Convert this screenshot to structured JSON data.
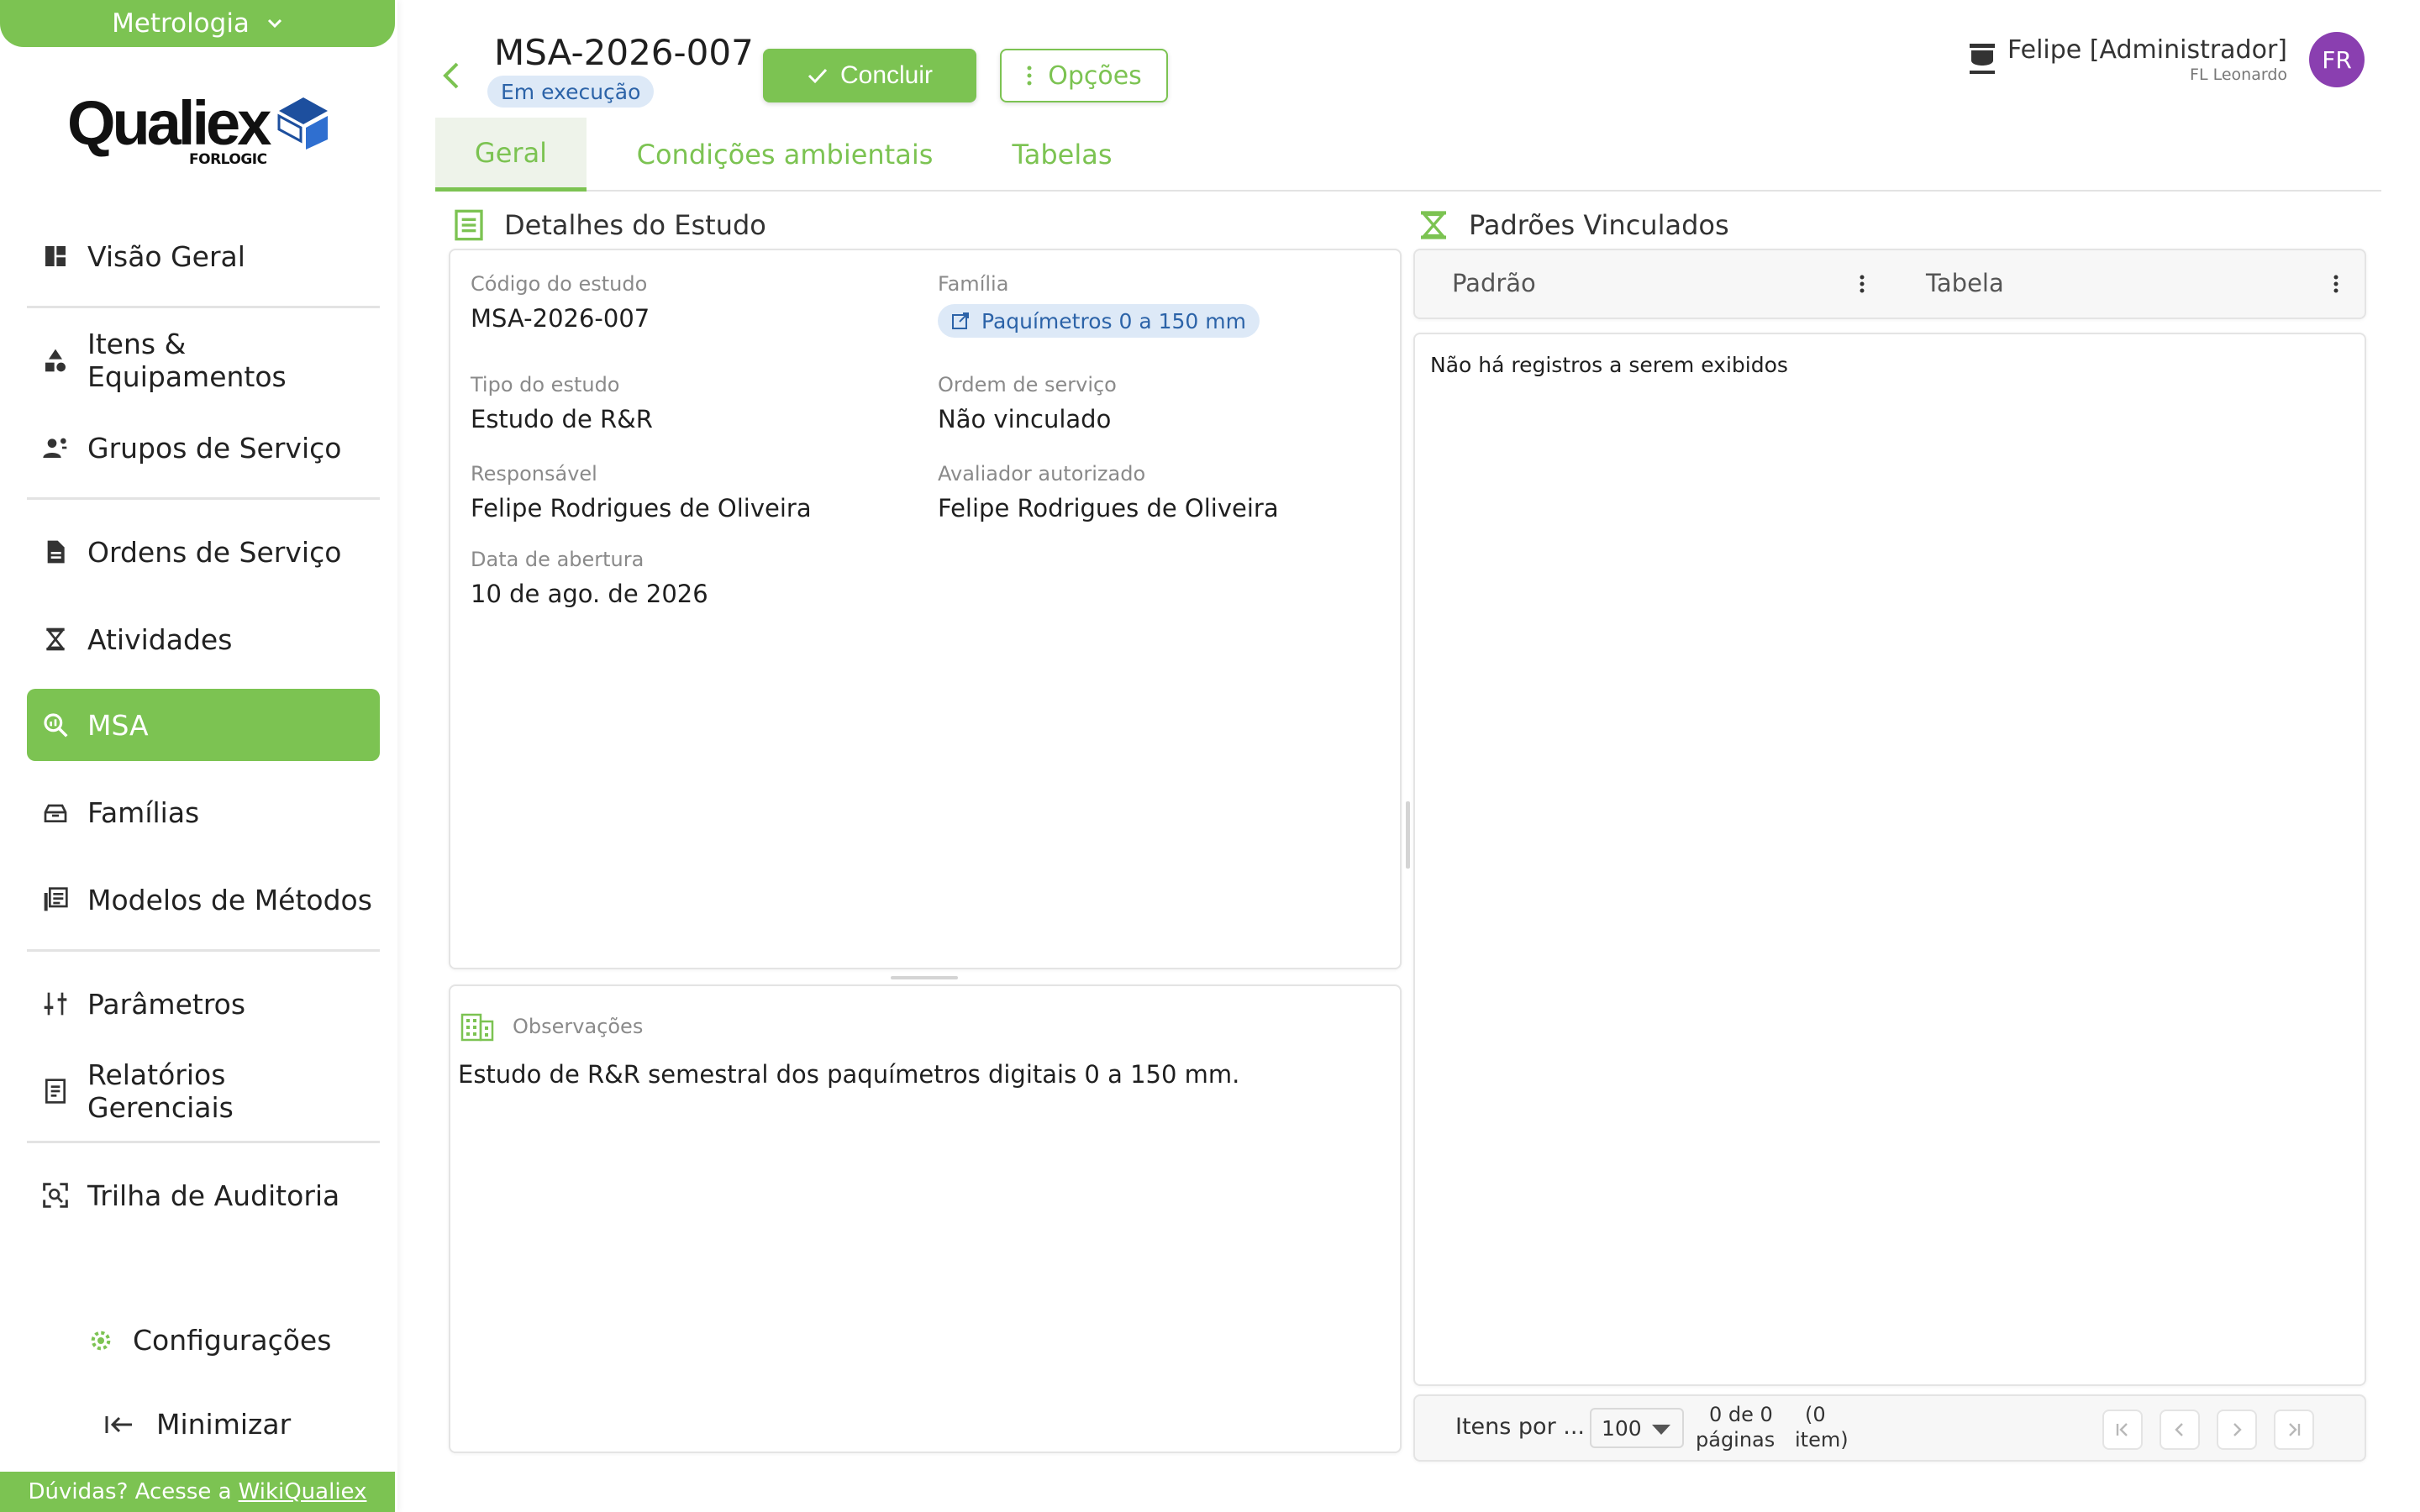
{
  "sidebar": {
    "module": "Metrologia",
    "logo": {
      "word": "Qualiex",
      "sub": "FORLOGIC"
    },
    "items": [
      {
        "label": "Visão Geral",
        "icon": "dashboard-icon"
      },
      {
        "label": "Itens & Equipamentos",
        "icon": "shapes-icon"
      },
      {
        "label": "Grupos de Serviço",
        "icon": "group-icon"
      },
      {
        "label": "Ordens de Serviço",
        "icon": "document-icon"
      },
      {
        "label": "Atividades",
        "icon": "hourglass-icon"
      },
      {
        "label": "MSA",
        "icon": "search-chart-icon",
        "active": true
      },
      {
        "label": "Famílias",
        "icon": "box-icon"
      },
      {
        "label": "Modelos de Métodos",
        "icon": "library-icon"
      },
      {
        "label": "Parâmetros",
        "icon": "sliders-icon"
      },
      {
        "label": "Relatórios Gerenciais",
        "icon": "report-icon"
      },
      {
        "label": "Trilha de Auditoria",
        "icon": "audit-icon"
      }
    ],
    "settings_label": "Configurações",
    "minimize_label": "Minimizar",
    "help_text": "Dúvidas? Acesse a",
    "help_link": "WikiQualiex"
  },
  "header": {
    "title": "MSA-2026-007",
    "status": "Em execução",
    "conclude_label": "Concluir",
    "options_label": "Opções",
    "user_name": "Felipe [Administrador]",
    "user_org": "FL Leonardo",
    "avatar_initials": "FR"
  },
  "tabs": [
    {
      "label": "Geral",
      "active": true
    },
    {
      "label": "Condições ambientais",
      "active": false
    },
    {
      "label": "Tabelas",
      "active": false
    }
  ],
  "details": {
    "section_title": "Detalhes do Estudo",
    "fields": {
      "codigo": {
        "label": "Código do estudo",
        "value": "MSA-2026-007"
      },
      "familia": {
        "label": "Família",
        "value": "Paquímetros 0 a 150 mm"
      },
      "tipo": {
        "label": "Tipo do estudo",
        "value": "Estudo de R&R"
      },
      "ordem": {
        "label": "Ordem de serviço",
        "value": "Não vinculado"
      },
      "responsavel": {
        "label": "Responsável",
        "value": "Felipe Rodrigues de Oliveira"
      },
      "avaliador": {
        "label": "Avaliador autorizado",
        "value": "Felipe Rodrigues de Oliveira"
      },
      "data": {
        "label": "Data de abertura",
        "value": "10 de ago. de 2026"
      }
    },
    "observations_label": "Observações",
    "observations_text": "Estudo de R&R semestral dos paquímetros digitais 0 a 150 mm."
  },
  "standards": {
    "section_title": "Padrões Vinculados",
    "columns": [
      "Padrão",
      "Tabela"
    ],
    "empty_message": "Não há registros a serem exibidos",
    "pagination": {
      "items_per_label": "Itens por ...",
      "page_size": "100",
      "page_count_top": "0 de 0",
      "page_count_bottom": "páginas",
      "item_count_top": "(0",
      "item_count_bottom": "item)"
    }
  },
  "colors": {
    "accent": "#7cc352",
    "badge_bg": "#dde9f7",
    "badge_text": "#2c63a8",
    "avatar": "#8a3fb0",
    "logo_blue": "#1d4f9e"
  }
}
